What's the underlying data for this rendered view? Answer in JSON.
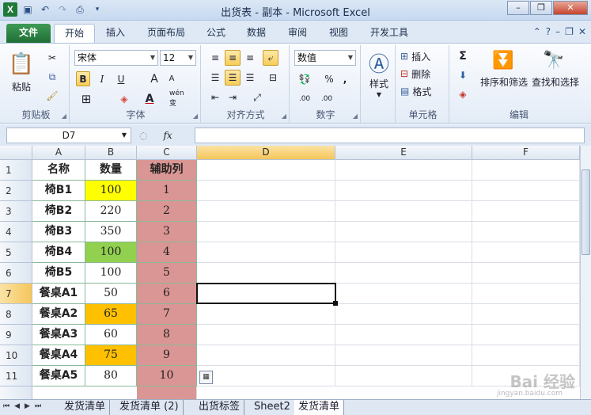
{
  "window": {
    "title": "出货表 - 副本 - Microsoft Excel",
    "app_icon": "X"
  },
  "ribbon_tabs": [
    "文件",
    "开始",
    "插入",
    "页面布局",
    "公式",
    "数据",
    "审阅",
    "视图",
    "开发工具"
  ],
  "ribbon": {
    "clipboard": {
      "label": "剪贴板",
      "paste": "粘贴"
    },
    "font": {
      "label": "字体",
      "font_name": "宋体",
      "font_size": "12",
      "bold": "B",
      "italic": "I",
      "underline": "U",
      "grow": "A",
      "shrink": "A",
      "wen": "wén 变"
    },
    "alignment": {
      "label": "对齐方式"
    },
    "number": {
      "label": "数字",
      "format": "数值",
      "percent": "%",
      "comma": ",",
      "inc_decimals": ".00",
      "dec_decimals": ".00"
    },
    "styles": {
      "label": "样式"
    },
    "cells": {
      "label": "单元格",
      "insert": "插入",
      "delete": "删除",
      "format": "格式"
    },
    "editing": {
      "label": "编辑",
      "sum": "Σ",
      "sort_filter": "排序和筛选",
      "find_select": "查找和选择"
    }
  },
  "formula_bar": {
    "name_box": "D7",
    "fx": "fx",
    "value": ""
  },
  "columns": [
    "A",
    "B",
    "C",
    "D",
    "E",
    "F"
  ],
  "selected_column": "D",
  "selected_row": "7",
  "rows": [
    {
      "n": "1",
      "a": "名称",
      "b": "数量",
      "c": "辅助列",
      "b_fill": "#ffffff",
      "c_fill": "#da9694"
    },
    {
      "n": "2",
      "a": "椅B1",
      "b": "100",
      "c": "1",
      "b_fill": "#ffff00",
      "c_fill": "#da9694"
    },
    {
      "n": "3",
      "a": "椅B2",
      "b": "220",
      "c": "2",
      "b_fill": "#ffffff",
      "c_fill": "#da9694"
    },
    {
      "n": "4",
      "a": "椅B3",
      "b": "350",
      "c": "3",
      "b_fill": "#ffffff",
      "c_fill": "#da9694"
    },
    {
      "n": "5",
      "a": "椅B4",
      "b": "100",
      "c": "4",
      "b_fill": "#92d050",
      "c_fill": "#da9694"
    },
    {
      "n": "6",
      "a": "椅B5",
      "b": "100",
      "c": "5",
      "b_fill": "#ffffff",
      "c_fill": "#da9694"
    },
    {
      "n": "7",
      "a": "餐桌A1",
      "b": "50",
      "c": "6",
      "b_fill": "#ffffff",
      "c_fill": "#da9694"
    },
    {
      "n": "8",
      "a": "餐桌A2",
      "b": "65",
      "c": "7",
      "b_fill": "#ffc000",
      "c_fill": "#da9694"
    },
    {
      "n": "9",
      "a": "餐桌A3",
      "b": "60",
      "c": "8",
      "b_fill": "#ffffff",
      "c_fill": "#da9694"
    },
    {
      "n": "10",
      "a": "餐桌A4",
      "b": "75",
      "c": "9",
      "b_fill": "#ffc000",
      "c_fill": "#da9694"
    },
    {
      "n": "11",
      "a": "餐桌A5",
      "b": "80",
      "c": "10",
      "b_fill": "#ffffff",
      "c_fill": "#da9694"
    }
  ],
  "sheet_tabs": [
    "发货清单",
    "发货清单 (2)",
    "出货标签",
    "Sheet2",
    "发货清单"
  ],
  "active_sheet_index": 4,
  "watermark": {
    "main": "Bai 经验",
    "sub": "jingyan.baidu.com"
  }
}
